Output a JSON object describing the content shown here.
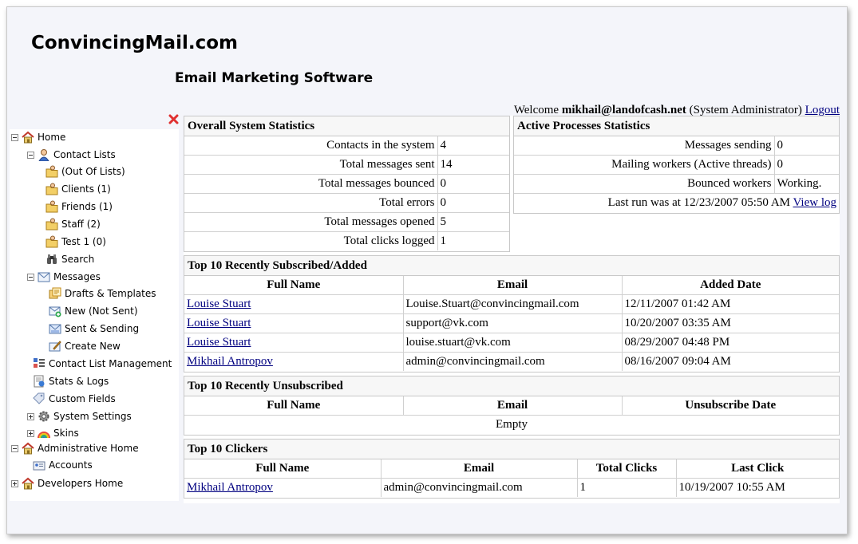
{
  "header": {
    "brand": "ConvincingMail.com",
    "subtitle": "Email Marketing Software",
    "welcome_prefix": "Welcome",
    "user_email": "mikhail@landofcash.net",
    "user_role": "(System Administrator)",
    "logout_label": "Logout"
  },
  "nav": {
    "home": "Home",
    "contact_lists": "Contact Lists",
    "out_of_lists": "(Out Of Lists)",
    "clients": "Clients (1)",
    "friends": "Friends (1)",
    "staff": "Staff (2)",
    "test1": "Test 1 (0)",
    "search": "Search",
    "messages": "Messages",
    "drafts": "Drafts & Templates",
    "new_not_sent": "New (Not Sent)",
    "sent_sending": "Sent & Sending",
    "create_new": "Create New",
    "contact_list_mgmt": "Contact List Management",
    "stats_logs": "Stats & Logs",
    "custom_fields": "Custom Fields",
    "system_settings": "System Settings",
    "skins": "Skins",
    "admin_home": "Administrative Home",
    "accounts": "Accounts",
    "dev_home": "Developers Home"
  },
  "overall": {
    "title": "Overall System Statistics",
    "rows": [
      {
        "label": "Contacts in the system",
        "value": "4"
      },
      {
        "label": "Total messages sent",
        "value": "14"
      },
      {
        "label": "Total messages bounced",
        "value": "0"
      },
      {
        "label": "Total errors",
        "value": "0"
      },
      {
        "label": "Total messages opened",
        "value": "5"
      },
      {
        "label": "Total clicks logged",
        "value": "1"
      }
    ]
  },
  "active": {
    "title": "Active Processes Statistics",
    "rows": [
      {
        "label": "Messages sending",
        "value": "0"
      },
      {
        "label": "Mailing workers (Active threads)",
        "value": "0"
      },
      {
        "label": "Bounced workers",
        "value": "Working."
      }
    ],
    "last_run": "Last run was at 12/23/2007 05:50 AM",
    "view_log": "View log"
  },
  "subscribed": {
    "title": "Top 10 Recently Subscribed/Added",
    "headers": [
      "Full Name",
      "Email",
      "Added Date"
    ],
    "rows": [
      {
        "name": "Louise Stuart",
        "email": "Louise.Stuart@convincingmail.com",
        "date": "12/11/2007 01:42 AM"
      },
      {
        "name": "Louise Stuart",
        "email": "support@vk.com",
        "date": "10/20/2007 03:35 AM"
      },
      {
        "name": "Louise Stuart",
        "email": "louise.stuart@vk.com",
        "date": "08/29/2007 04:48 PM"
      },
      {
        "name": "Mikhail Antropov",
        "email": "admin@convincingmail.com",
        "date": "08/16/2007 09:04 AM"
      }
    ]
  },
  "unsubscribed": {
    "title": "Top 10 Recently Unsubscribed",
    "headers": [
      "Full Name",
      "Email",
      "Unsubscribe Date"
    ],
    "empty": "Empty"
  },
  "clickers": {
    "title": "Top 10 Clickers",
    "headers": [
      "Full Name",
      "Email",
      "Total Clicks",
      "Last Click"
    ],
    "rows": [
      {
        "name": "Mikhail Antropov",
        "email": "admin@convincingmail.com",
        "clicks": "1",
        "last": "10/19/2007 10:55 AM"
      }
    ]
  }
}
